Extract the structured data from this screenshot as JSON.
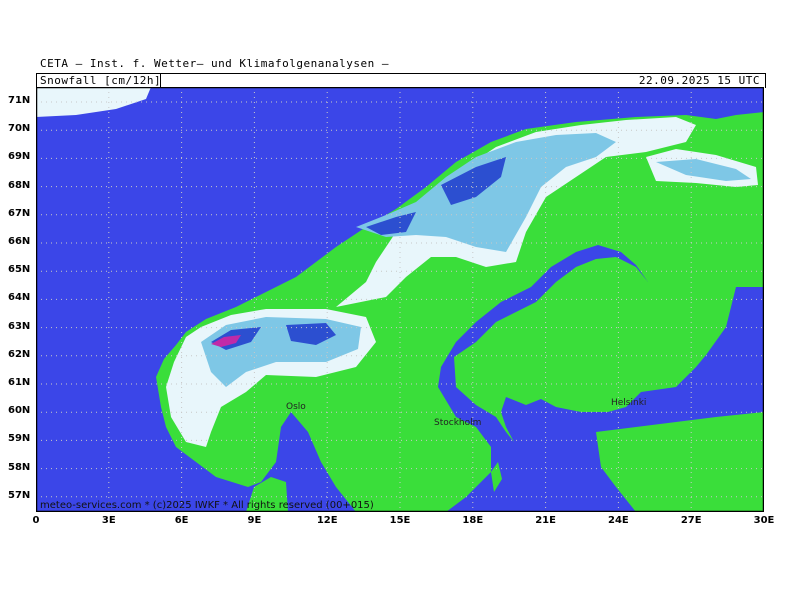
{
  "header": {
    "organization": "CETA – Inst. f. Wetter– und Klimafolgenanalysen –",
    "parameter": "Snowfall [cm/12h]",
    "valid_time": "22.09.2025 15 UTC"
  },
  "footer": "meteo-services.com * (c)2025 IWKF * All rights reserved (00+015)",
  "axes": {
    "lat_labels": [
      "71N",
      "70N",
      "69N",
      "68N",
      "67N",
      "66N",
      "65N",
      "64N",
      "63N",
      "62N",
      "61N",
      "60N",
      "59N",
      "58N",
      "57N"
    ],
    "lon_labels": [
      "0",
      "3E",
      "6E",
      "9E",
      "12E",
      "15E",
      "18E",
      "21E",
      "24E",
      "27E",
      "30E"
    ]
  },
  "cities": {
    "oslo": "Oslo",
    "stockholm": "Stockholm",
    "helsinki": "Helsinki"
  },
  "colors": {
    "sea": "#3b46e8",
    "land": "#3ade3a",
    "snow_light": "#e8f6fb",
    "snow_mid": "#7ec7e6",
    "snow_heavy": "#2c4fd0",
    "snow_extreme": "#c02aa8",
    "grid": "#c8c8c8"
  }
}
